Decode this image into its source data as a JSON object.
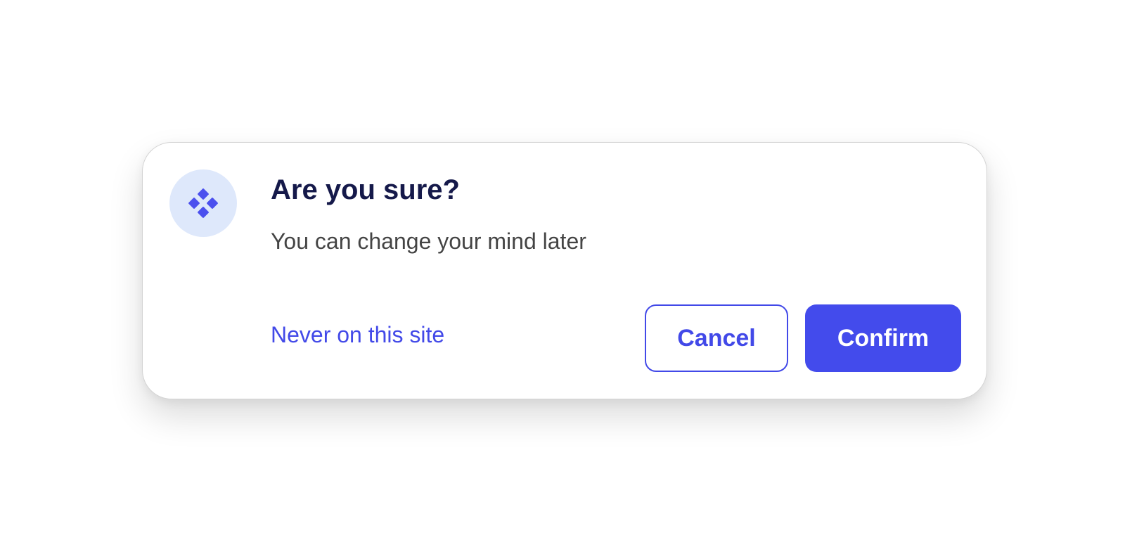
{
  "dialog": {
    "icon": "diamond-grid-icon",
    "title": "Are you sure?",
    "message": "You can change your mind later",
    "never_link": "Never on this site",
    "cancel_label": "Cancel",
    "confirm_label": "Confirm"
  },
  "colors": {
    "accent": "#434bec",
    "icon_badge_bg": "#dee8fb",
    "title": "#15194a",
    "message": "#444444"
  }
}
